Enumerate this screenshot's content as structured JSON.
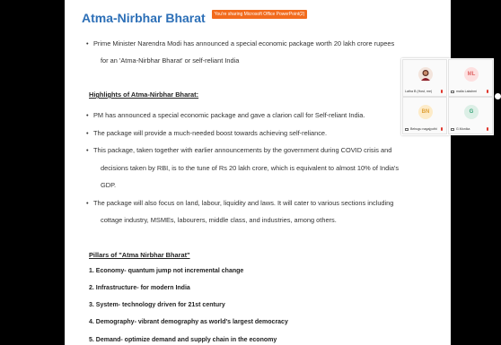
{
  "share_banner": "You're sharing Microsoft Office PowerPoint(2)",
  "slide": {
    "title": "Atma-Nirbhar Bharat",
    "intro_line1": "Prime Minister Narendra Modi has announced a special economic package worth 20 lakh crore rupees",
    "intro_line2": "for an 'Atma-Nirbhar Bharat' or self-reliant India",
    "highlights_heading": "Highlights of Atma-Nirbhar Bharat:",
    "h1": "PM has announced a special economic package and gave a clarion call for Self-reliant India.",
    "h2": "The package will provide a much-needed boost towards achieving self-reliance.",
    "h3_line1": "This package, taken together with earlier announcements by the government during COVID crisis and",
    "h3_line2": "decisions taken by RBI, is to the tune of Rs 20 lakh crore, which is equivalent to almost 10% of India's",
    "h3_line3": "GDP.",
    "h4_line1": "The package will also focus on land, labour, liquidity and laws. It will cater to various sections including",
    "h4_line2": "cottage industry, MSMEs, labourers, middle class, and industries, among others.",
    "pillars_heading": "Pillars of \"Atma Nirbhar Bharat\"",
    "p1": "1. Economy- quantum jump not incremental change",
    "p2": "2. Infrastructure- for modern India",
    "p3": "3. System- technology driven for 21st century",
    "p4": "4. Demography- vibrant demography as world's largest democracy",
    "p5": "5. Demand- optimize demand and supply chain in the economy"
  },
  "participants": [
    {
      "initials": "",
      "name": "Latha B (Host, me)",
      "color": "#f3e4dc"
    },
    {
      "initials": "ML",
      "name": "malia Lakshmi",
      "color": "#fde0e0"
    },
    {
      "initials": "BN",
      "name": "Bebugu nagajyothi",
      "color": "#fdebc8"
    },
    {
      "initials": "G",
      "name": "G.Monika",
      "color": "#dcefe6"
    }
  ],
  "colors": {
    "title": "#2c6fb7",
    "banner": "#f26b1d",
    "mic_muted": "#e0362c"
  }
}
